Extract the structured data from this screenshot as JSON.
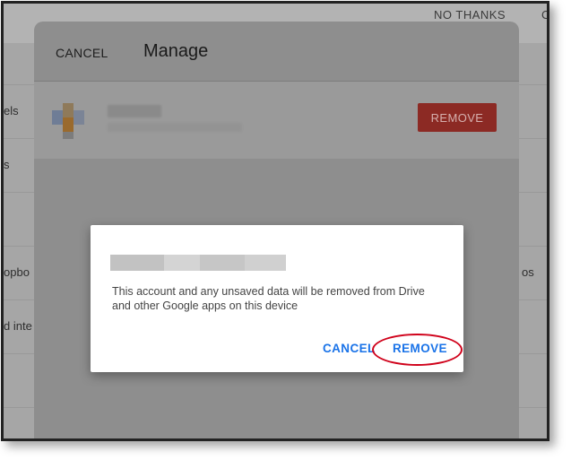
{
  "background": {
    "no_thanks": "NO THANKS",
    "corner_fragment": "C",
    "side_texts": [
      "els",
      "s",
      "opbo",
      "d inte",
      "os"
    ]
  },
  "manage_sheet": {
    "cancel_label": "CANCEL",
    "title": "Manage",
    "remove_label": "REMOVE"
  },
  "dialog": {
    "message": "This account and any unsaved data will be removed from Drive and other Google apps on this device",
    "cancel_label": "CANCEL",
    "remove_label": "REMOVE"
  },
  "colors": {
    "accent_blue": "#1a73e8",
    "remove_red": "#c0392b",
    "annotation_red": "#d0021b"
  }
}
